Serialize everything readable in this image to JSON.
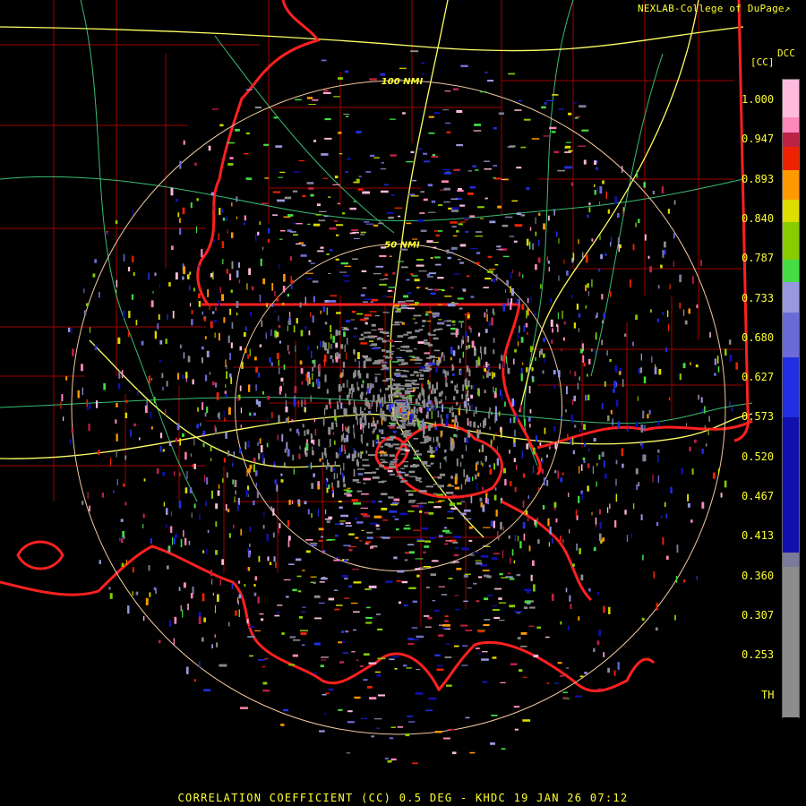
{
  "title": "CORRELATION COEFFICIENT (CC) 0.5 DEG - KHDC 19 JAN 26 07:12",
  "credit": "NEXLAB-College of DuPage",
  "credit_icon": "external-link-icon",
  "product_code": "DCC",
  "unit_label": "[CC]",
  "legend_ticks": [
    "1.000",
    "0.947",
    "0.893",
    "0.840",
    "0.787",
    "0.733",
    "0.680",
    "0.627",
    "0.573",
    "0.520",
    "0.467",
    "0.413",
    "0.360",
    "0.307",
    "0.253",
    "TH"
  ],
  "range_rings": [
    {
      "label": "100 NMI",
      "nmi": 100
    },
    {
      "label": "50 NMI",
      "nmi": 50
    }
  ],
  "colors": {
    "text": "#ffff33",
    "county_lines": "#a00000",
    "state_lines": "#ff2020",
    "highways": "#ffff66",
    "roads": "#44dd88",
    "range_rings": "#f0c8a0"
  },
  "color_scale": [
    {
      "from": 0.2,
      "to": 0.4,
      "color": "#8c8c8c"
    },
    {
      "from": 0.4,
      "to": 0.42,
      "color": "#7a7a9a"
    },
    {
      "from": 0.42,
      "to": 0.6,
      "color": "#1010b0"
    },
    {
      "from": 0.6,
      "to": 0.68,
      "color": "#2030e0"
    },
    {
      "from": 0.68,
      "to": 0.74,
      "color": "#6a6ad8"
    },
    {
      "from": 0.74,
      "to": 0.78,
      "color": "#9898e0"
    },
    {
      "from": 0.78,
      "to": 0.81,
      "color": "#44dd44"
    },
    {
      "from": 0.81,
      "to": 0.86,
      "color": "#88cc00"
    },
    {
      "from": 0.86,
      "to": 0.89,
      "color": "#dddd00"
    },
    {
      "from": 0.89,
      "to": 0.93,
      "color": "#ff9900"
    },
    {
      "from": 0.93,
      "to": 0.96,
      "color": "#ee2200"
    },
    {
      "from": 0.96,
      "to": 0.98,
      "color": "#bb2244"
    },
    {
      "from": 0.98,
      "to": 1.0,
      "color": "#ff88bb"
    },
    {
      "from": 1.0,
      "to": 1.05,
      "color": "#ffbbdd"
    }
  ]
}
